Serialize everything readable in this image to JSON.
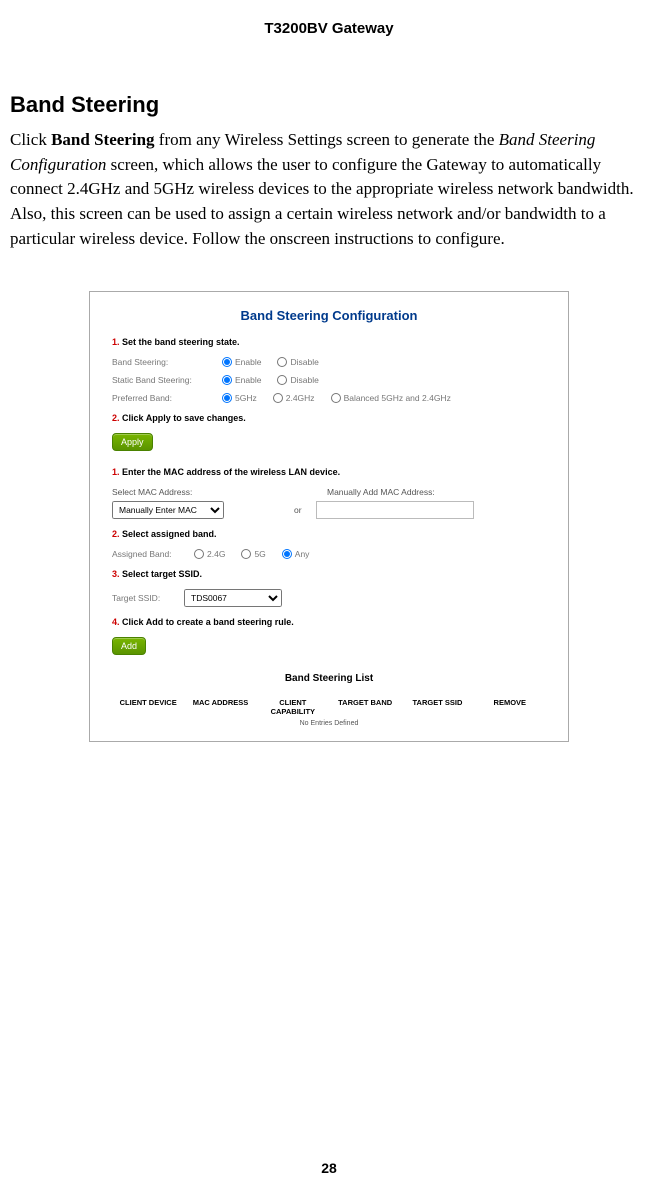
{
  "header": {
    "title": "T3200BV Gateway"
  },
  "section": {
    "heading": "Band Steering",
    "para_pre": "Click ",
    "para_clickbold": "Band Steering",
    "para_mid1": " from any Wireless Settings screen to generate the ",
    "para_italic": "Band Steering Configuration",
    "para_rest": " screen, which allows the user to configure the Gateway to automatically connect 2.4GHz and 5GHz wireless devices to the appropriate wireless network bandwidth. Also, this screen can be used to assign a certain wireless network and/or bandwidth to a particular wireless device. Follow the onscreen instructions to configure."
  },
  "panel": {
    "title": "Band Steering Configuration",
    "step1_num": "1.",
    "step1_text": " Set the band steering state.",
    "row_band_steering_label": "Band Steering:",
    "opt_enable": "Enable",
    "opt_disable": "Disable",
    "row_static_label": "Static Band Steering:",
    "row_pref_label": "Preferred Band:",
    "opt_5ghz": "5GHz",
    "opt_24ghz": "2.4GHz",
    "opt_balanced": "Balanced 5GHz and 2.4GHz",
    "step2_num": "2.",
    "step2_text": " Click Apply to save changes.",
    "btn_apply": "Apply",
    "stepA1_num": "1.",
    "stepA1_text": " Enter the MAC address of the wireless LAN device.",
    "mac_select_label": "Select MAC Address:",
    "mac_manual_label": "Manually Add MAC Address:",
    "mac_select_value": "Manually Enter MAC",
    "mac_or": "or",
    "mac_input_value": "",
    "stepA2_num": "2.",
    "stepA2_text": " Select assigned band.",
    "row_assigned_label": "Assigned Band:",
    "opt_a24": "2.4G",
    "opt_a5": "5G",
    "opt_any": "Any",
    "stepA3_num": "3.",
    "stepA3_text": " Select target SSID.",
    "row_ssid_label": "Target SSID:",
    "ssid_value": "TDS0067",
    "stepA4_num": "4.",
    "stepA4_text": " Click Add to create a band steering rule.",
    "btn_add": "Add",
    "list_title": "Band Steering List",
    "col1": "CLIENT DEVICE",
    "col2": "MAC ADDRESS",
    "col3": "CLIENT CAPABILITY",
    "col4": "TARGET BAND",
    "col5": "TARGET SSID",
    "col6": "REMOVE",
    "no_entries": "No Entries Defined"
  },
  "page_number": "28"
}
